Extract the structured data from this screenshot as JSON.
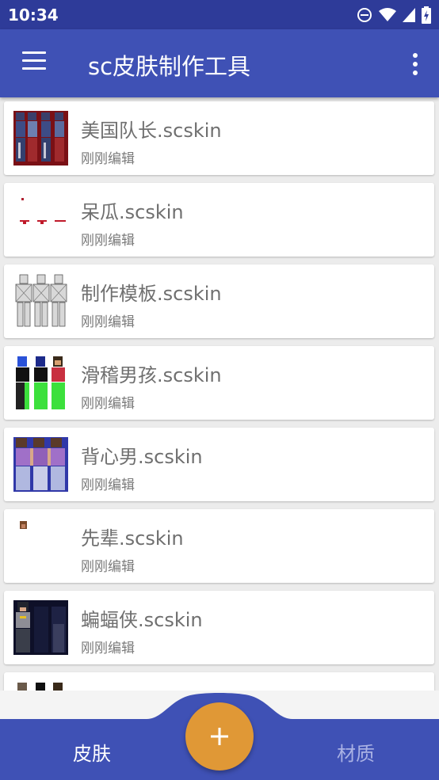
{
  "status_bar": {
    "time": "10:34"
  },
  "app_bar": {
    "title": "sc皮肤制作工具"
  },
  "skins": [
    {
      "name": "美国队长.scskin",
      "subtitle": "刚刚编辑",
      "thumbnail": "captain-america-skin"
    },
    {
      "name": "呆瓜.scskin",
      "subtitle": "刚刚编辑",
      "thumbnail": "dumb-skin"
    },
    {
      "name": "制作模板.scskin",
      "subtitle": "刚刚编辑",
      "thumbnail": "template-skin"
    },
    {
      "name": "滑稽男孩.scskin",
      "subtitle": "刚刚编辑",
      "thumbnail": "funny-boy-skin"
    },
    {
      "name": "背心男.scskin",
      "subtitle": "刚刚编辑",
      "thumbnail": "vest-man-skin"
    },
    {
      "name": "先辈.scskin",
      "subtitle": "刚刚编辑",
      "thumbnail": "senpai-skin"
    },
    {
      "name": "蝙蝠侠.scskin",
      "subtitle": "刚刚编辑",
      "thumbnail": "batman-skin"
    },
    {
      "name": "",
      "subtitle": "",
      "thumbnail": "partial-skin"
    }
  ],
  "bottom_nav": {
    "skins_label": "皮肤",
    "materials_label": "材质"
  },
  "colors": {
    "primary": "#3f51b5",
    "primary_dark": "#2e3b99",
    "accent": "#e09836"
  }
}
